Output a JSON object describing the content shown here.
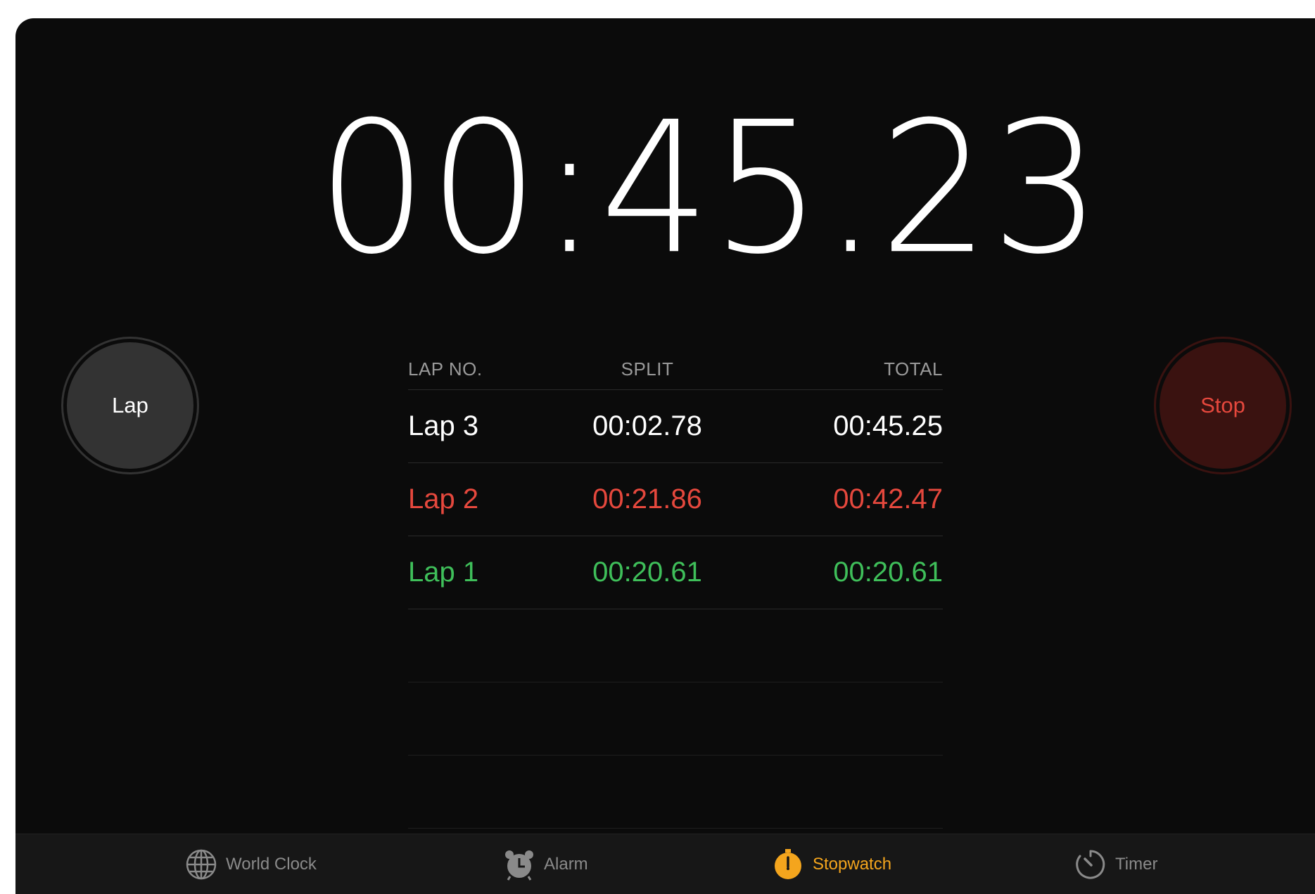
{
  "stopwatch": {
    "time": "00:45.23"
  },
  "buttons": {
    "lap_label": "Lap",
    "stop_label": "Stop"
  },
  "laps_table": {
    "headers": {
      "lap_no": "LAP NO.",
      "split": "SPLIT",
      "total": "TOTAL"
    },
    "rows": [
      {
        "lap": "Lap 3",
        "split": "00:02.78",
        "total": "00:45.25",
        "color": "#ffffff"
      },
      {
        "lap": "Lap 2",
        "split": "00:21.86",
        "total": "00:42.47",
        "color": "#e5483d"
      },
      {
        "lap": "Lap 1",
        "split": "00:20.61",
        "total": "00:20.61",
        "color": "#3fbf5a"
      }
    ]
  },
  "tabbar": {
    "tabs": [
      {
        "label": "World Clock",
        "icon": "globe-icon",
        "active": false
      },
      {
        "label": "Alarm",
        "icon": "alarm-clock-icon",
        "active": false
      },
      {
        "label": "Stopwatch",
        "icon": "stopwatch-icon",
        "active": true
      },
      {
        "label": "Timer",
        "icon": "timer-icon",
        "active": false
      }
    ]
  },
  "colors": {
    "background": "#0b0b0b",
    "accent": "#f4a51d",
    "stop_red": "#e5483d",
    "best_lap_green": "#3fbf5a",
    "worst_lap_red": "#e5483d"
  }
}
